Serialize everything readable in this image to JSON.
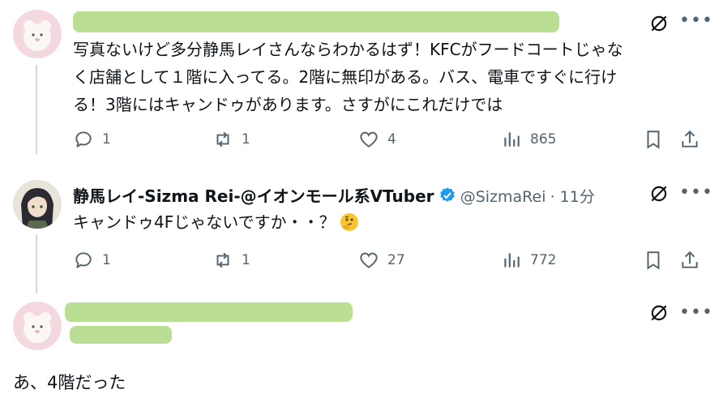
{
  "tweet1": {
    "text_line1": "写真ないけど多分静馬レイさんならわかるはず！KFCがフードコートじゃな",
    "text_line2": "く店舗として１階に入ってる。2階に無印がある。バス、電車ですぐに行け",
    "text_line3": "る！3階にはキャンドゥがあります。さすがにこれだけでは",
    "replies": "1",
    "retweets": "1",
    "likes": "4",
    "views": "865"
  },
  "tweet2": {
    "name": "静馬レイ-Sizma Rei-@イオンモール系VTuber",
    "handle": "@SizmaRei",
    "time": "· 11分",
    "text": "キャンドゥ4Fじゃないですか・・？",
    "replies": "1",
    "retweets": "1",
    "likes": "27",
    "views": "772"
  },
  "tweet3": {
    "text": "あ、4階だった"
  },
  "icons": {
    "reply": "reply-icon",
    "retweet": "retweet-icon",
    "like": "heart-icon",
    "views": "views-icon",
    "bookmark": "bookmark-icon",
    "share": "share-icon",
    "grok": "grok-icon",
    "more": "more-icon",
    "verified": "verified-badge-icon"
  },
  "colors": {
    "text": "#0f1419",
    "muted": "#536471",
    "verified": "#1d9bf0",
    "redaction": "#b5dc8e",
    "thread_line": "#cfd9de"
  }
}
